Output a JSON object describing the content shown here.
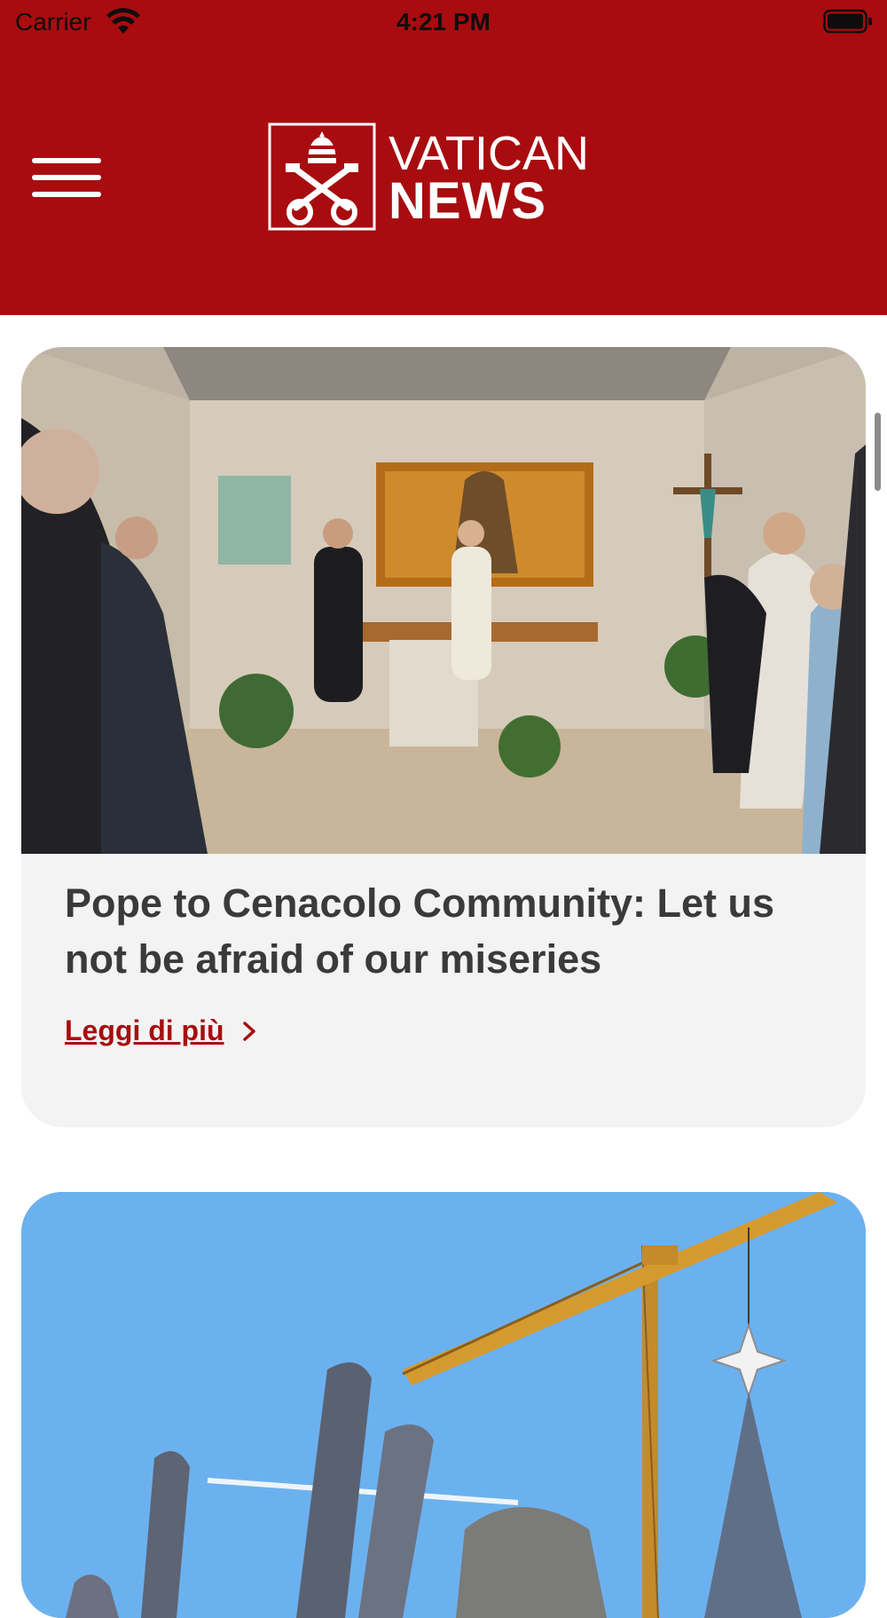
{
  "status_bar": {
    "carrier": "Carrier",
    "time": "4:21 PM"
  },
  "header": {
    "logo_line1": "VATICAN",
    "logo_line2": "NEWS",
    "menu_icon": "hamburger-menu-icon"
  },
  "articles": [
    {
      "title": "Pope to Cenacolo Community: Let us not be afraid of our miseries",
      "read_more": "Leggi di più"
    }
  ],
  "colors": {
    "brand_red": "#a80c0f",
    "card_background": "#f3f3f3",
    "title_text": "#3a3a3c"
  }
}
